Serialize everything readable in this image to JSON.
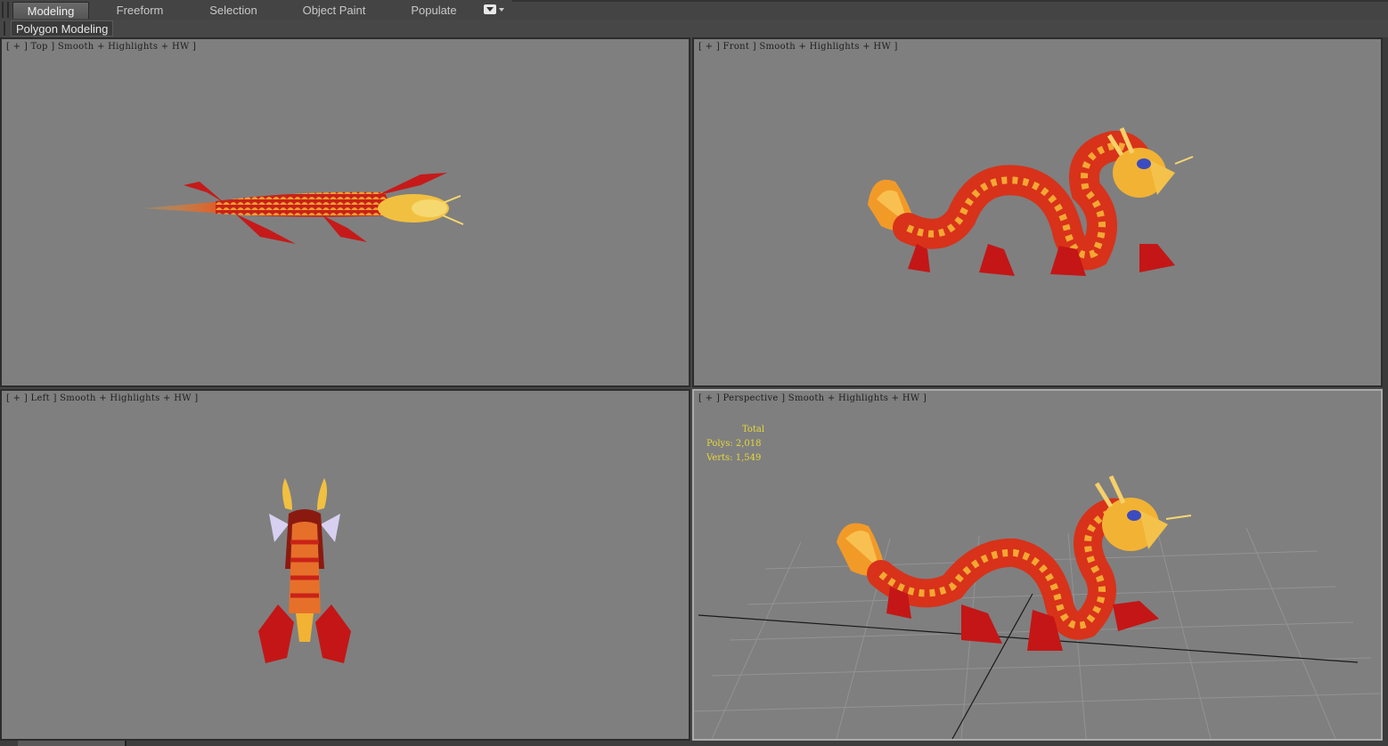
{
  "ribbon": {
    "tabs": [
      {
        "label": "Modeling",
        "active": true
      },
      {
        "label": "Freeform",
        "active": false
      },
      {
        "label": "Selection",
        "active": false
      },
      {
        "label": "Object Paint",
        "active": false
      },
      {
        "label": "Populate",
        "active": false
      }
    ],
    "panel_button": "Polygon Modeling"
  },
  "viewports": {
    "top": {
      "label": "[ + ] Top ] Smooth + Highlights + HW ]"
    },
    "front": {
      "label": "[ + ] Front ] Smooth + Highlights + HW ]"
    },
    "left": {
      "label": "[ + ] Left ] Smooth + Highlights + HW ]"
    },
    "perspective": {
      "label": "[ + ] Perspective ] Smooth + Highlights + HW ]"
    }
  },
  "statistics": {
    "title": "Total",
    "polys": "Polys: 2,018",
    "verts": "Verts: 1,549"
  },
  "colors": {
    "viewport_bg": "#7f7f7f",
    "stats_text": "#e5d83a",
    "dragon_red": "#c8201a",
    "dragon_gold": "#f2b233"
  }
}
